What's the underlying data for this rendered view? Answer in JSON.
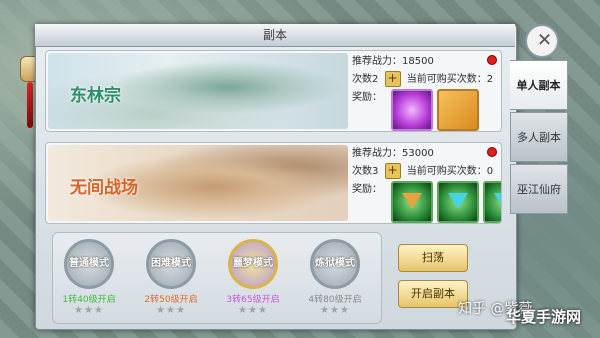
{
  "window": {
    "title": "副本"
  },
  "tabs": [
    {
      "label": "单人副本",
      "active": true
    },
    {
      "label": "多人副本",
      "active": false
    },
    {
      "label": "巫江仙府",
      "active": false
    }
  ],
  "dungeons": [
    {
      "name": "东林宗",
      "power_label": "推荐战力：",
      "power": "18500",
      "times_label": "次数2",
      "buy_label": "当前可购买次数：2",
      "reward_label": "奖励：",
      "rewards": [
        "purple-orb-reward-icon",
        "gold-scroll-reward-icon"
      ]
    },
    {
      "name": "无间战场",
      "power_label": "推荐战力：",
      "power": "53000",
      "times_label": "次数3",
      "buy_label": "当前可购买次数：0",
      "reward_label": "奖励：",
      "rewards": [
        "orange-triangle-gem-icon",
        "cyan-triangle-gem-icon",
        "cyan-triangle-gem-icon"
      ]
    }
  ],
  "modes": [
    {
      "label": "普通模式",
      "req": "1转40级开启",
      "req_color": "#3cbc3a",
      "stars": "★★★"
    },
    {
      "label": "困难模式",
      "req": "2转50级开启",
      "req_color": "#e26a2c",
      "stars": "★★★"
    },
    {
      "label": "噩梦模式",
      "req": "3转65级开启",
      "req_color": "#c25ad4",
      "stars": "★★★"
    },
    {
      "label": "炼狱模式",
      "req": "4转80级开启",
      "req_color": "#8a8a8a",
      "stars": "★★★"
    }
  ],
  "buttons": {
    "sweep": "扫荡",
    "open": "开启副本"
  },
  "watermark": "知乎 @紫薇",
  "logo": "华夏手游网",
  "colors": {
    "accent_gold": "#e6c56a",
    "alert_red": "#e01f1f"
  }
}
